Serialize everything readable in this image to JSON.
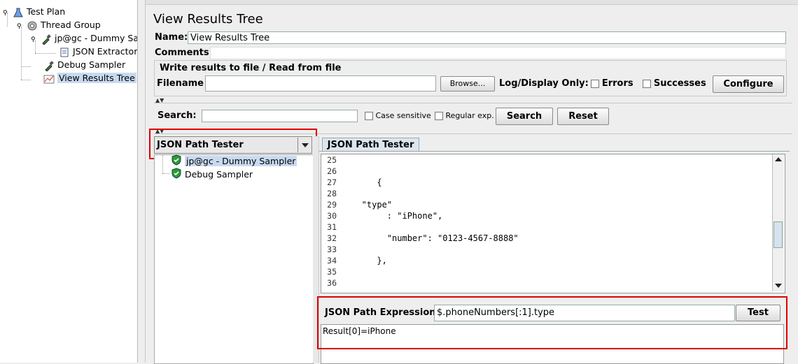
{
  "tree": {
    "items": [
      {
        "label": "Test Plan",
        "icon": "test-plan-icon"
      },
      {
        "label": "Thread Group",
        "icon": "thread-group-icon"
      },
      {
        "label": "jp@gc - Dummy Sampler",
        "icon": "dropper-icon"
      },
      {
        "label": "JSON Extractor",
        "icon": "extractor-icon"
      },
      {
        "label": "Debug Sampler",
        "icon": "dropper-icon"
      },
      {
        "label": "View Results Tree",
        "icon": "chart-icon"
      }
    ]
  },
  "panel": {
    "title": "View Results Tree",
    "name_label": "Name:",
    "name_value": "View Results Tree",
    "comments_label": "Comments:",
    "file_group_title": "Write results to file / Read from file",
    "filename_label": "Filename",
    "browse_label": "Browse...",
    "log_display_label": "Log/Display Only:",
    "errors_label": "Errors",
    "successes_label": "Successes",
    "configure_label": "Configure"
  },
  "search": {
    "label": "Search:",
    "case_sensitive_label": "Case sensitive",
    "regular_exp_label": "Regular exp.",
    "search_button": "Search",
    "reset_button": "Reset"
  },
  "renderer": {
    "selected": "JSON Path Tester",
    "tab_label": "JSON Path Tester"
  },
  "results": [
    {
      "label": "jp@gc - Dummy Sampler",
      "status": "success"
    },
    {
      "label": "Debug Sampler",
      "status": "success"
    }
  ],
  "code": {
    "lines": [
      {
        "n": "25",
        "text": ""
      },
      {
        "n": "26",
        "text": ""
      },
      {
        "n": "27",
        "text": "      {"
      },
      {
        "n": "28",
        "text": ""
      },
      {
        "n": "29",
        "text": "   \"type\""
      },
      {
        "n": "30",
        "text": "        : \"iPhone\","
      },
      {
        "n": "31",
        "text": ""
      },
      {
        "n": "32",
        "text": "        \"number\": \"0123-4567-8888\""
      },
      {
        "n": "33",
        "text": ""
      },
      {
        "n": "34",
        "text": "      },"
      },
      {
        "n": "35",
        "text": ""
      },
      {
        "n": "36",
        "text": ""
      }
    ]
  },
  "expression": {
    "label": "JSON Path Expression",
    "value": "$.phoneNumbers[:1].type",
    "test_button": "Test",
    "result": "Result[0]=iPhone"
  },
  "colors": {
    "highlight": "#e00000",
    "selection": "#c8daf0"
  }
}
